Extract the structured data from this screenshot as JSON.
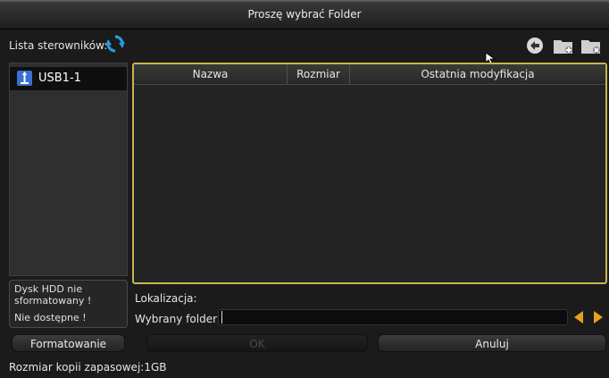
{
  "dialog": {
    "title": "Proszę wybrać Folder"
  },
  "drivers": {
    "label": "Lista sterowników:",
    "items": [
      {
        "label": "USB1-1",
        "icon": "usb-icon"
      }
    ]
  },
  "status": {
    "line1": "Dysk HDD nie",
    "line2": "sformatowany !",
    "line3": "Nie dostępne !"
  },
  "table": {
    "columns": [
      "Nazwa",
      "Rozmiar",
      "Ostatnia modyfikacja"
    ],
    "rows": []
  },
  "location": {
    "label": "Lokalizacja:",
    "value": ""
  },
  "selected_folder": {
    "label": "Wybrany folder:",
    "value": ""
  },
  "buttons": {
    "format": "Formatowanie",
    "ok": "OK",
    "cancel": "Anuluj"
  },
  "footer": {
    "backup_size": "Rozmiar kopii zapasowej:1GB"
  },
  "colors": {
    "accent_border": "#c6b64e",
    "arrow": "#e8a21a",
    "refresh": "#2a9be0"
  }
}
